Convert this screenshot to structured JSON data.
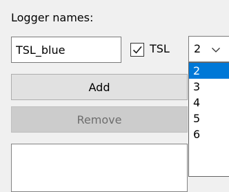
{
  "logger_names": {
    "heading": "Logger names:",
    "name_input_value": "TSL_blue",
    "tsl_checkbox": {
      "checked": true,
      "label": "TSL"
    },
    "count_select": {
      "value": "2",
      "options": [
        "2",
        "3",
        "4",
        "5",
        "6"
      ],
      "highlighted_index": 0
    }
  },
  "buttons": {
    "add_label": "Add",
    "remove_label": "Remove"
  },
  "colors": {
    "highlight": "#0078d7",
    "window_bg": "#f0f0f0",
    "button_bg": "#e1e1e1",
    "disabled_bg": "#cccccc",
    "disabled_text": "#6d6d6d"
  },
  "icons": {
    "checkbox_mark": "check-icon",
    "select_arrow": "chevron-down-icon"
  }
}
